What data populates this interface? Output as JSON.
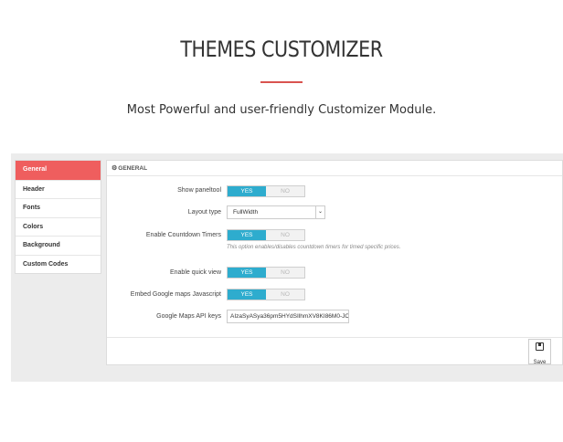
{
  "header": {
    "title": "THEMES CUSTOMIZER",
    "subtitle": "Most Powerful and user-friendly Customizer Module."
  },
  "sidebar": {
    "items": [
      {
        "label": "General",
        "active": true
      },
      {
        "label": "Header",
        "active": false
      },
      {
        "label": "Fonts",
        "active": false
      },
      {
        "label": "Colors",
        "active": false
      },
      {
        "label": "Background",
        "active": false
      },
      {
        "label": "Custom Codes",
        "active": false
      }
    ]
  },
  "panel": {
    "title": "GENERAL",
    "show_paneltool": {
      "label": "Show paneltool",
      "yes": "YES",
      "no": "NO",
      "value": "YES"
    },
    "layout_type": {
      "label": "Layout type",
      "value": "FullWidth"
    },
    "countdown": {
      "label": "Enable Countdown Timers",
      "yes": "YES",
      "no": "NO",
      "value": "YES",
      "hint": "This option enables/disables countdown timers for timed specific prices."
    },
    "quick_view": {
      "label": "Enable quick view",
      "yes": "YES",
      "no": "NO",
      "value": "YES"
    },
    "google_maps_js": {
      "label": "Embed Google maps Javascript",
      "yes": "YES",
      "no": "NO",
      "value": "YES"
    },
    "api_keys": {
      "label": "Google Maps API keys",
      "value": "AIzaSyASya36pm5HYdSIlhmXV8KI86M0-JC"
    },
    "save_label": "Save"
  },
  "colors": {
    "accent_red": "#ef5e5e",
    "toggle_blue": "#2eacce",
    "rule_red": "#d9534f"
  }
}
